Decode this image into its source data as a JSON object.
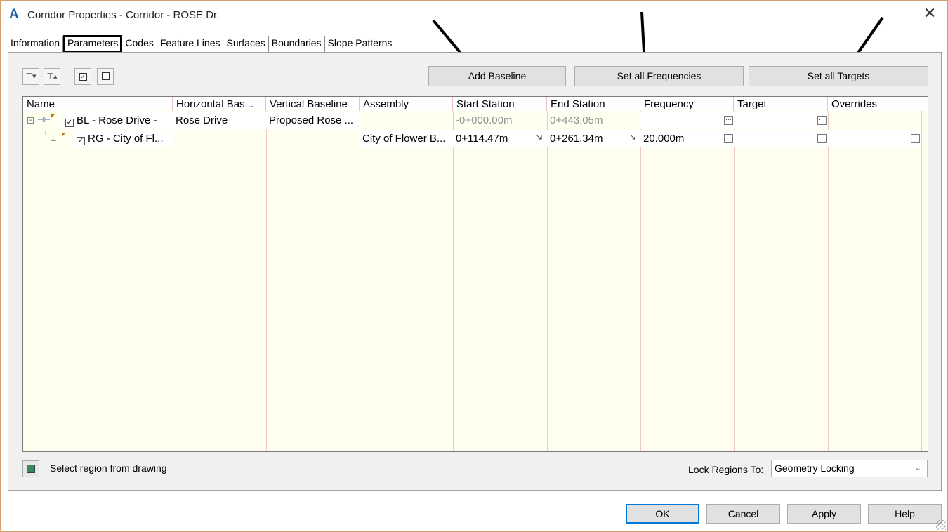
{
  "window": {
    "title": "Corridor Properties - Corridor - ROSE Dr."
  },
  "tabs": [
    {
      "label": "Information",
      "active": false
    },
    {
      "label": "Parameters",
      "active": true
    },
    {
      "label": "Codes",
      "active": false
    },
    {
      "label": "Feature Lines",
      "active": false
    },
    {
      "label": "Surfaces",
      "active": false
    },
    {
      "label": "Boundaries",
      "active": false
    },
    {
      "label": "Slope Patterns",
      "active": false
    }
  ],
  "toolbar": {
    "add_baseline": "Add Baseline",
    "set_all_frequencies": "Set all Frequencies",
    "set_all_targets": "Set all Targets"
  },
  "grid": {
    "columns": [
      "Name",
      "Horizontal Bas...",
      "Vertical Baseline",
      "Assembly",
      "Start Station",
      "End Station",
      "Frequency",
      "Target",
      "Overrides"
    ],
    "rows": [
      {
        "name": "BL - Rose Drive -",
        "horizontal": "Rose Drive",
        "vertical": "Proposed Rose ...",
        "assembly": "",
        "start": "-0+000.00m",
        "end": "0+443.05m",
        "frequency": "",
        "target": "",
        "overrides": "",
        "checked": true
      },
      {
        "name": "RG - City of Fl...",
        "horizontal": "",
        "vertical": "",
        "assembly": "City of Flower B...",
        "start": "0+114.47m",
        "end": "0+261.34m",
        "frequency": "20.000m",
        "target": "",
        "overrides": "",
        "checked": true
      }
    ]
  },
  "region": {
    "select_label": "Select region from drawing"
  },
  "lock": {
    "label": "Lock Regions To:",
    "value": "Geometry Locking"
  },
  "footer": {
    "ok": "OK",
    "cancel": "Cancel",
    "apply": "Apply",
    "help": "Help"
  },
  "icons": {
    "checkbox_mark": "☑",
    "tree_expand": "−",
    "ellipsis": "···",
    "close": "✕",
    "chevron": "⌄"
  }
}
